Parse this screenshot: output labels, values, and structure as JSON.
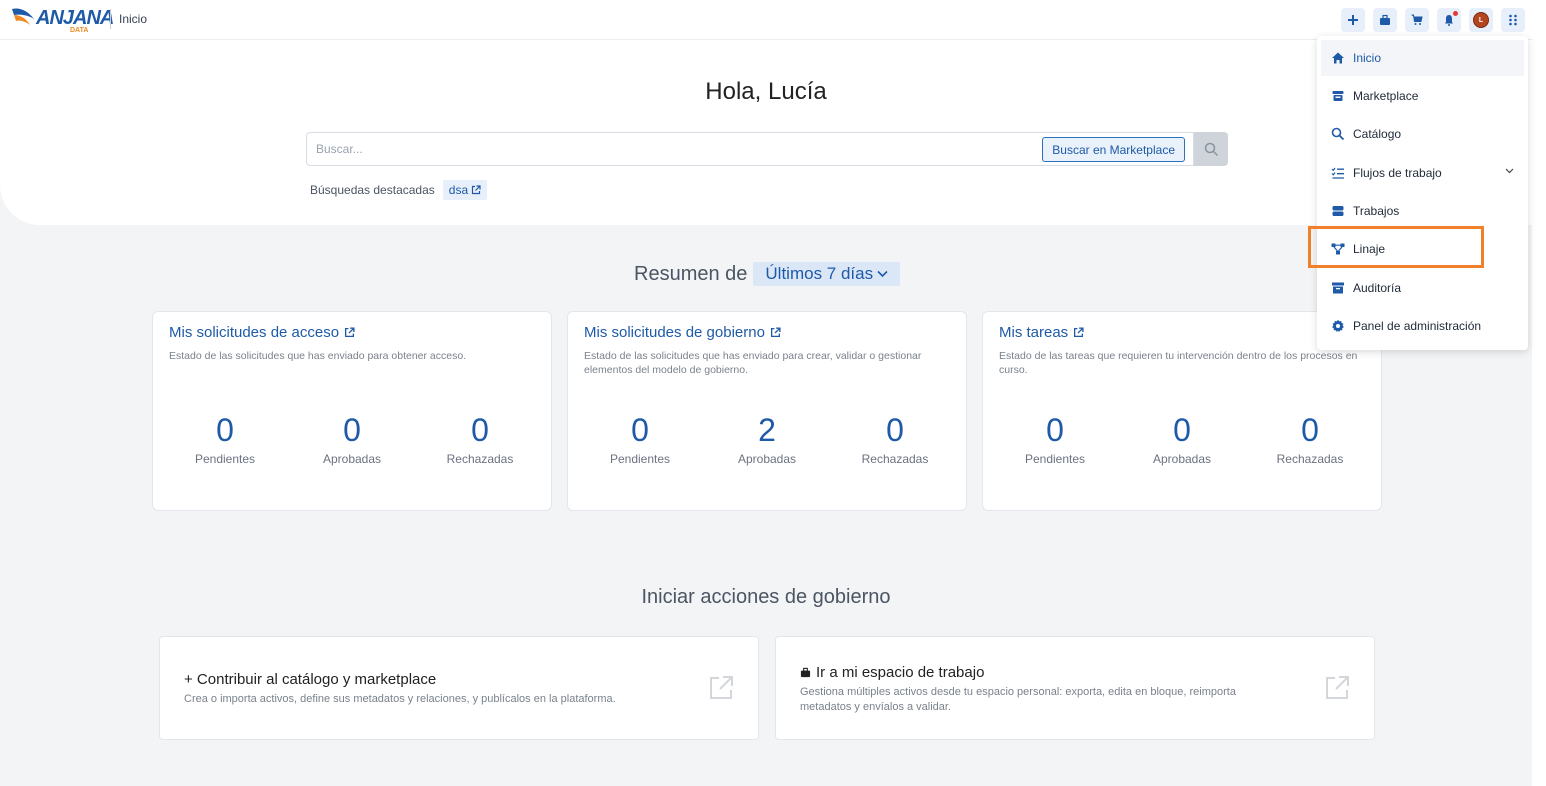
{
  "brand": {
    "logo_text": "ANJANA",
    "logo_sub": "DATA"
  },
  "breadcrumb": "Inicio",
  "topbar_icons": [
    {
      "name": "add-icon"
    },
    {
      "name": "briefcase-icon"
    },
    {
      "name": "cart-icon"
    },
    {
      "name": "bell-icon"
    },
    {
      "name": "avatar",
      "initial": "L"
    },
    {
      "name": "apps-grid-icon"
    }
  ],
  "hero": {
    "greeting": "Hola, Lucía",
    "search_placeholder": "Buscar...",
    "marketplace_button": "Buscar en Marketplace",
    "featured_label": "Búsquedas destacadas",
    "featured_chip": "dsa"
  },
  "summary": {
    "title": "Resumen de",
    "range": "Últimos 7 días"
  },
  "cards": [
    {
      "title": "Mis solicitudes de acceso",
      "desc": "Estado de las solicitudes que has enviado para obtener acceso.",
      "stats": [
        {
          "value": "0",
          "label": "Pendientes"
        },
        {
          "value": "0",
          "label": "Aprobadas"
        },
        {
          "value": "0",
          "label": "Rechazadas"
        }
      ]
    },
    {
      "title": "Mis solicitudes de gobierno",
      "desc": "Estado de las solicitudes que has enviado para crear, validar o gestionar elementos del modelo de gobierno.",
      "stats": [
        {
          "value": "0",
          "label": "Pendientes"
        },
        {
          "value": "2",
          "label": "Aprobadas"
        },
        {
          "value": "0",
          "label": "Rechazadas"
        }
      ]
    },
    {
      "title": "Mis tareas",
      "desc": "Estado de las tareas que requieren tu intervención dentro de los procesos en curso.",
      "stats": [
        {
          "value": "0",
          "label": "Pendientes"
        },
        {
          "value": "0",
          "label": "Aprobadas"
        },
        {
          "value": "0",
          "label": "Rechazadas"
        }
      ]
    }
  ],
  "actions": {
    "title": "Iniciar acciones de gobierno",
    "items": [
      {
        "title": "+ Contribuir al catálogo y marketplace",
        "desc": "Crea o importa activos, define sus metadatos y relaciones, y publícalos en la plataforma."
      },
      {
        "title": "Ir a mi espacio de trabajo",
        "desc": "Gestiona múltiples activos desde tu espacio personal: exporta, edita en bloque, reimporta metadatos y envíalos a validar."
      }
    ]
  },
  "menu": {
    "items": [
      {
        "label": "Inicio",
        "icon": "home-icon",
        "active": true
      },
      {
        "label": "Marketplace",
        "icon": "store-icon"
      },
      {
        "label": "Catálogo",
        "icon": "search-icon"
      },
      {
        "label": "Flujos de trabajo",
        "icon": "checklist-icon",
        "expandable": true
      },
      {
        "label": "Trabajos",
        "icon": "server-icon"
      },
      {
        "label": "Linaje",
        "icon": "lineage-icon",
        "highlighted": true
      },
      {
        "label": "Auditoría",
        "icon": "archive-icon"
      },
      {
        "label": "Panel de administración",
        "icon": "gear-icon"
      }
    ]
  },
  "colors": {
    "primary": "#1e5aa8",
    "highlight": "#f0802a",
    "background": "#f3f4f6",
    "avatar": "#b4451f"
  }
}
